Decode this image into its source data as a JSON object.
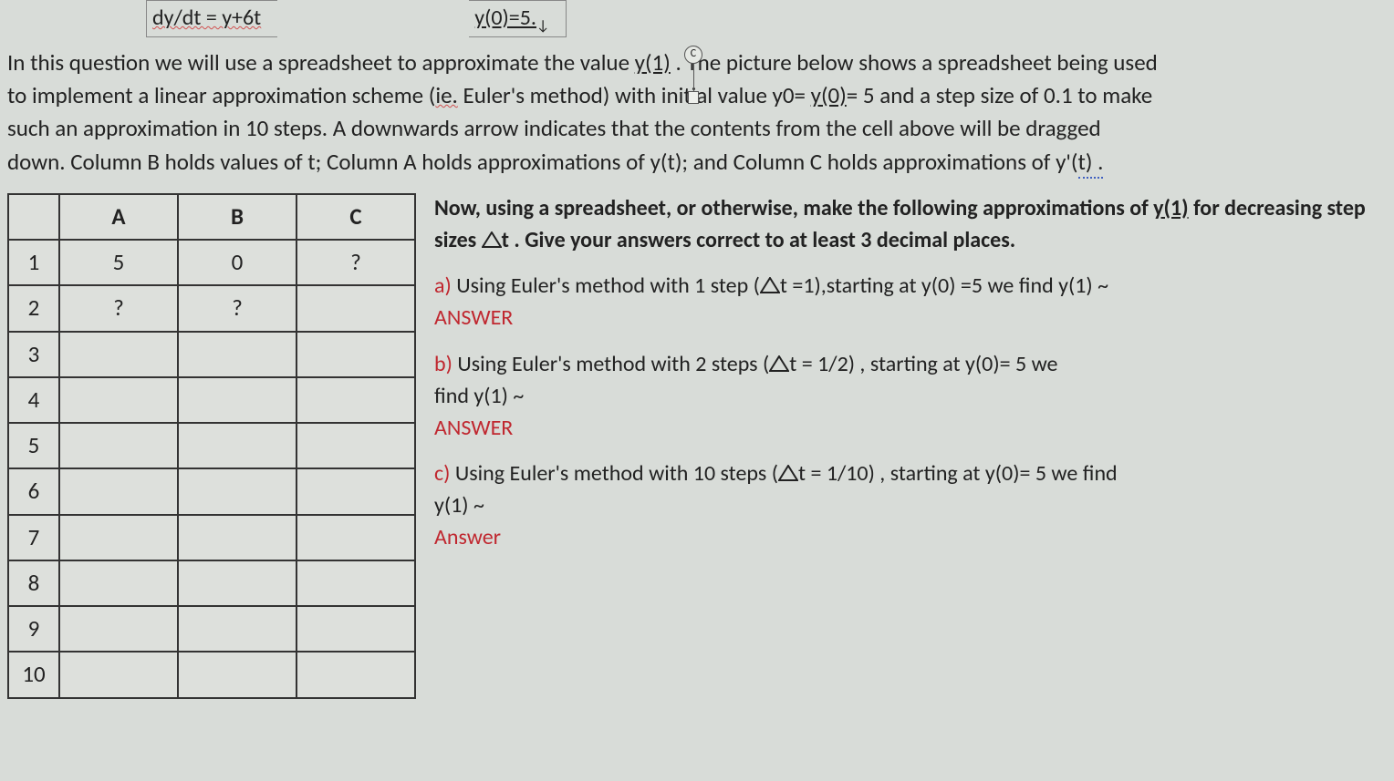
{
  "formula": {
    "left": "dy/dt = y+6t",
    "right": "y(0)=5.",
    "cursor_glyph": "↓"
  },
  "marker": {
    "label": "C"
  },
  "intro": {
    "l1_a": "In this question we will use a spreadsheet to approximate the value ",
    "l1_y1": "y(1)",
    "l1_b": " . The picture below shows a spreadsheet being used",
    "l2_a": "to implement a linear approximation scheme (",
    "l2_ie": "ie.",
    "l2_b": " Euler's method) with initial value y0= ",
    "l2_y0": "y(0)",
    "l2_c": "= 5 and a step size of 0.1 to make",
    "l3": "such an approximation in 10 steps. A downwards arrow indicates that the contents from the cell above will be dragged",
    "l4_a": "down.  Column B holds values of t; Column A holds approximations of y(t); and Column C holds approximations of y'(",
    "l4_tail": "t) ."
  },
  "table": {
    "cols": [
      "A",
      "B",
      "C"
    ],
    "rows": [
      "1",
      "2",
      "3",
      "4",
      "5",
      "6",
      "7",
      "8",
      "9",
      "10"
    ],
    "cells": {
      "r1": [
        "5",
        "0",
        "?"
      ],
      "r2": [
        "?",
        "?",
        ""
      ],
      "r3": [
        "",
        "",
        ""
      ],
      "r4": [
        "",
        "",
        ""
      ],
      "r5": [
        "",
        "",
        ""
      ],
      "r6": [
        "",
        "",
        ""
      ],
      "r7": [
        "",
        "",
        ""
      ],
      "r8": [
        "",
        "",
        ""
      ],
      "r9": [
        "",
        "",
        ""
      ],
      "r10": [
        "",
        "",
        ""
      ]
    }
  },
  "q": {
    "head_a": "Now, using a spreadsheet, or otherwise, make the following approximations of ",
    "head_y1": "y(1)",
    "head_b": " for decreasing step sizes ",
    "head_tri_t": "t",
    "head_c": " . Give your answers correct to at least 3 decimal places.",
    "a_label": "a)",
    "a_text1": " Using Euler's method with 1 step (",
    "a_tri": "t",
    "a_text2": " =1),starting at y(0) =5 we find y(1) ~",
    "a_ans": "ANSWER",
    "b_label": "b)",
    "b_text1": "  Using Euler's method with 2 steps (",
    "b_tri": "t",
    "b_text2": " = 1/2) , starting at y(0)= 5 we",
    "b_text3": "find y(1) ~",
    "b_ans": "ANSWER",
    "c_label": "c)",
    "c_text1": "  Using Euler's method with 10 steps (",
    "c_tri": "t",
    "c_text2": " = 1/10) , starting at y(0)= 5  we find",
    "c_text3": "y(1) ~",
    "c_ans": "Answer"
  }
}
